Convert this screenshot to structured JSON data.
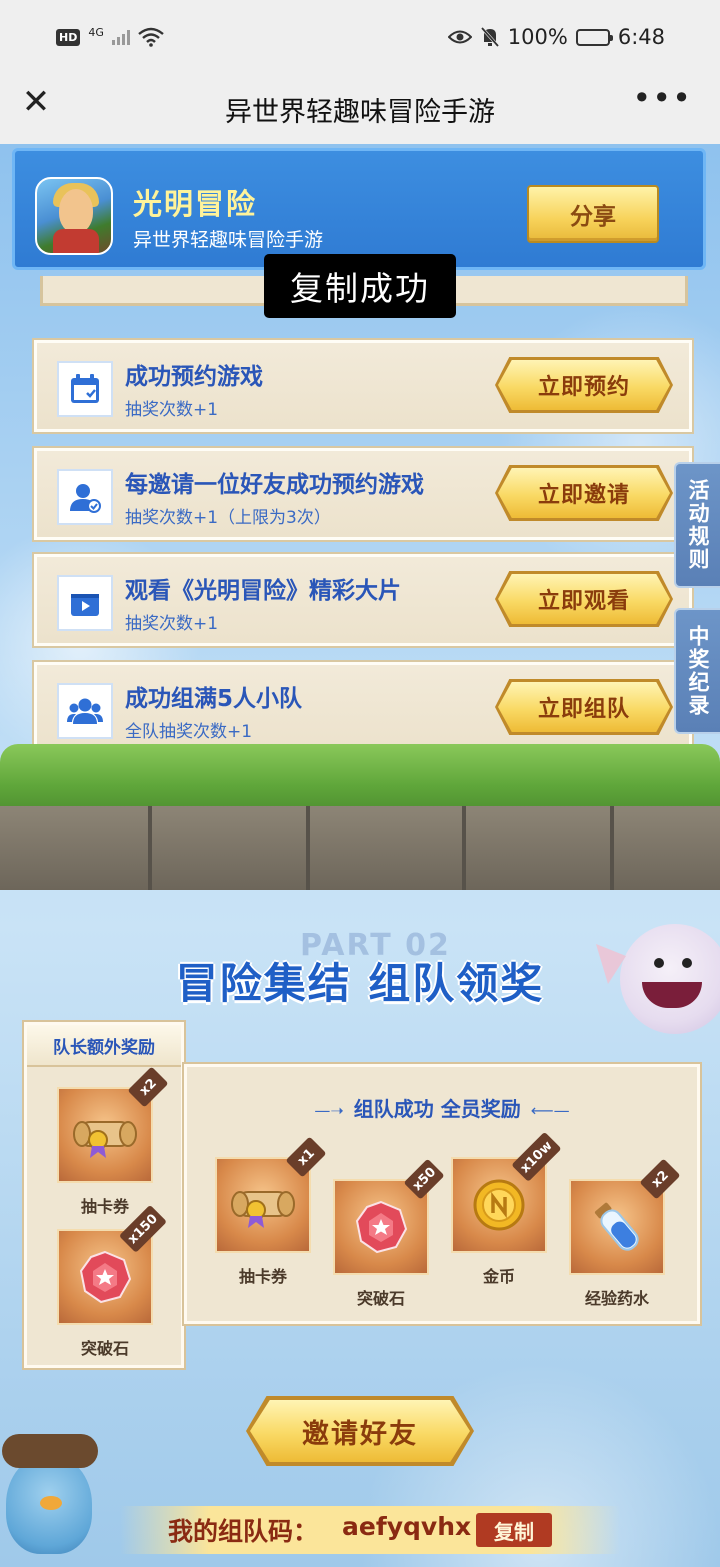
{
  "status_bar": {
    "hd": "HD",
    "network": "4G",
    "battery_text": "100%",
    "time": "6:48",
    "battery_level": 1.0
  },
  "nav": {
    "title": "异世界轻趣味冒险手游",
    "more": "•••",
    "close": "✕"
  },
  "header": {
    "app_name": "光明冒险",
    "app_subtitle": "异世界轻趣味冒险手游",
    "share_label": "分享"
  },
  "toast": "复制成功",
  "tasks": [
    {
      "title": "成功预约游戏",
      "subtitle": "抽奖次数+1",
      "button": "立即预约",
      "icon": "calendar-icon"
    },
    {
      "title": "每邀请一位好友成功预约游戏",
      "subtitle": "抽奖次数+1（上限为3次）",
      "button": "立即邀请",
      "icon": "invite-user-icon"
    },
    {
      "title": "观看《光明冒险》精彩大片",
      "subtitle": "抽奖次数+1",
      "button": "立即观看",
      "icon": "video-icon"
    },
    {
      "title": "成功组满5人小队",
      "subtitle": "全队抽奖次数+1",
      "button": "立即组队",
      "icon": "team-icon"
    }
  ],
  "side_tabs": {
    "rules": "活动规则",
    "records": "中奖纪录"
  },
  "section": {
    "part_label": "PART 02",
    "title": "冒险集结 组队领奖"
  },
  "leader_rewards": {
    "title": "队长额外奖励",
    "items": [
      {
        "name": "抽卡券",
        "qty": "x2",
        "icon": "scroll-icon"
      },
      {
        "name": "突破石",
        "qty": "x150",
        "icon": "gem-icon"
      }
    ]
  },
  "team_rewards": {
    "title": "组队成功 全员奖励",
    "items": [
      {
        "name": "抽卡券",
        "qty": "x1",
        "icon": "scroll-icon"
      },
      {
        "name": "突破石",
        "qty": "x50",
        "icon": "gem-icon"
      },
      {
        "name": "金币",
        "qty": "x10w",
        "icon": "coin-icon"
      },
      {
        "name": "经验药水",
        "qty": "x2",
        "icon": "potion-icon"
      }
    ]
  },
  "invite": {
    "label": "邀请好友"
  },
  "team_code": {
    "label": "我的组队码：",
    "value": "aefyqvhx",
    "copy_label": "复制"
  },
  "colors": {
    "primary_blue": "#2a56b8",
    "gold": "#f9d964",
    "parchment": "#efe6d2",
    "brown_text": "#8a3c0c"
  }
}
